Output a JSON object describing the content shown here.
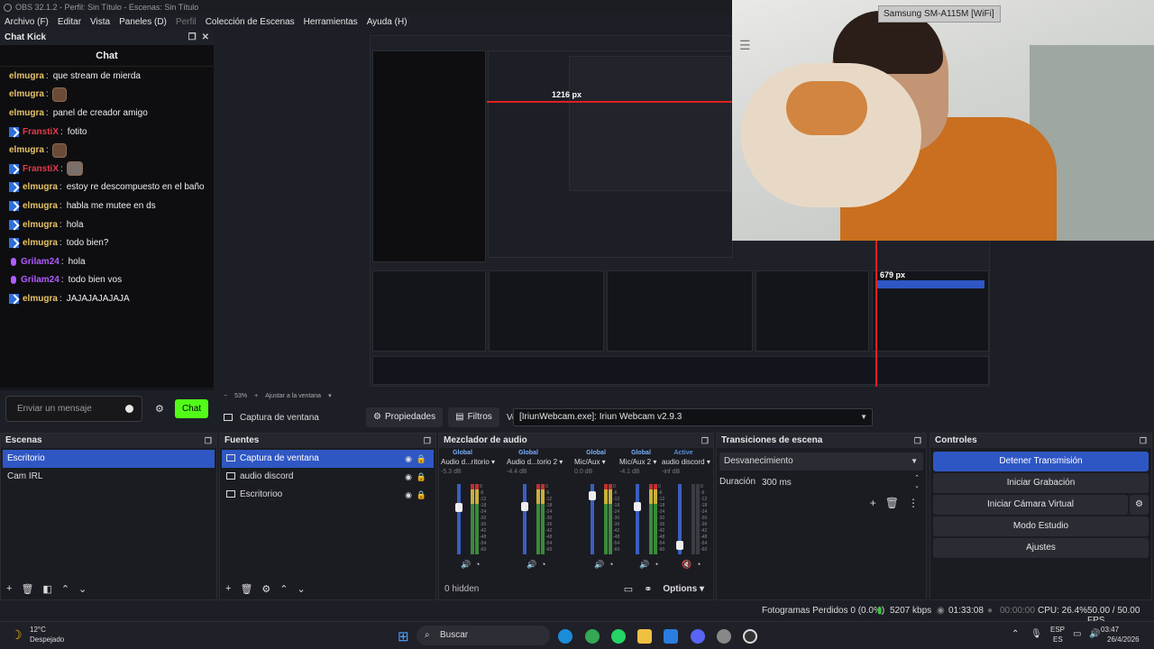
{
  "window": {
    "title": "OBS 32.1.2 - Perfil: Sin Título - Escenas: Sin Título"
  },
  "menu": [
    "Archivo (F)",
    "Editar",
    "Vista",
    "Paneles (D)",
    "Perfil",
    "Colección de Escenas",
    "Herramientas",
    "Ayuda (H)"
  ],
  "chat_dock": {
    "title": "Chat Kick",
    "panel_title": "Chat",
    "messages": [
      {
        "user": "elmugra",
        "text": "que stream de mierda",
        "badge": false,
        "color": "#e8c469",
        "emote": ""
      },
      {
        "user": "elmugra",
        "text": "",
        "badge": false,
        "color": "#e8c469",
        "emote": "face"
      },
      {
        "user": "elmugra",
        "text": "panel de creador amigo",
        "badge": false,
        "color": "#e8c469",
        "emote": ""
      },
      {
        "user": "FranstiX",
        "text": "fotito",
        "badge": true,
        "color": "#e23b4b",
        "emote": ""
      },
      {
        "user": "elmugra",
        "text": "",
        "badge": false,
        "color": "#e8c469",
        "emote": "face"
      },
      {
        "user": "FranstiX",
        "text": "",
        "badge": true,
        "color": "#e23b4b",
        "emote": "cat"
      },
      {
        "user": "elmugra",
        "text": "estoy re descompuesto en el baño",
        "badge": true,
        "color": "#e8c469",
        "emote": ""
      },
      {
        "user": "elmugra",
        "text": "habla me mutee en ds",
        "badge": true,
        "color": "#e8c469",
        "emote": ""
      },
      {
        "user": "elmugra",
        "text": "hola",
        "badge": true,
        "color": "#e8c469",
        "emote": ""
      },
      {
        "user": "elmugra",
        "text": "todo bien?",
        "badge": true,
        "color": "#e8c469",
        "emote": ""
      },
      {
        "user": "Grilam24",
        "text": "hola",
        "badge": "mic",
        "color": "#b05cff",
        "emote": ""
      },
      {
        "user": "Grilam24",
        "text": "todo bien vos",
        "badge": "mic",
        "color": "#b05cff",
        "emote": ""
      },
      {
        "user": "elmugra",
        "text": "JAJAJAJAJAJA",
        "badge": true,
        "color": "#e8c469",
        "emote": ""
      }
    ],
    "input_placeholder": "Enviar un mensaje",
    "send_label": "Chat"
  },
  "preview": {
    "webcam_device": "Samsung SM-A115M [WiFi]",
    "measure_h": "1216 px",
    "measure_v": "679 px",
    "zoom": "53%",
    "zoom_fit": "Ajustar a la ventana"
  },
  "source_toolbar": {
    "source_name": "Captura de ventana",
    "properties": "Propiedades",
    "filters": "Filtros",
    "window_label": "Ventana",
    "window_value": "[IriunWebcam.exe]: Iriun Webcam v2.9.3"
  },
  "scenes": {
    "title": "Escenas",
    "items": [
      "Escritorio",
      "Cam IRL"
    ]
  },
  "sources": {
    "title": "Fuentes",
    "items": [
      "Captura de ventana",
      "audio discord",
      "Escritorioo"
    ]
  },
  "mixer": {
    "title": "Mezclador de audio",
    "channels": [
      {
        "mode": "Global",
        "name": "Audio d...ritorio",
        "db": "-5.3 dB",
        "level": 0.7
      },
      {
        "mode": "Global",
        "name": "Audio d...torio 2",
        "db": "-4.4 dB",
        "level": 0.72
      },
      {
        "mode": "Global",
        "name": "Mic/Aux",
        "db": "0.0 dB",
        "level": 0.88
      },
      {
        "mode": "Global",
        "name": "Mic/Aux 2",
        "db": "-4.1 dB",
        "level": 0.72
      },
      {
        "mode": "Active",
        "name": "audio discord",
        "db": "-inf dB",
        "level": 0.1
      }
    ],
    "ticks": [
      "0",
      "-6",
      "-12",
      "-18",
      "-24",
      "-30",
      "-36",
      "-42",
      "-48",
      "-54",
      "-60"
    ],
    "hidden": "0 hidden",
    "options": "Options"
  },
  "transitions": {
    "title": "Transiciones de escena",
    "selected": "Desvanecimiento",
    "duration_label": "Duración",
    "duration_value": "300 ms"
  },
  "controls": {
    "title": "Controles",
    "stop_stream": "Detener Transmisión",
    "start_rec": "Iniciar Grabación",
    "virtual_cam": "Iniciar Cámara Virtual",
    "studio": "Modo Estudio",
    "settings": "Ajustes"
  },
  "status": {
    "dropped": "Fotogramas Perdidos 0 (0.0%)",
    "bitrate": "5207 kbps",
    "stream_time": "01:33:08",
    "rec_time": "00:00:00",
    "cpu": "CPU: 26.4%",
    "fps": "50.00 / 50.00 FPS"
  },
  "taskbar": {
    "temp": "12°C",
    "weather": "Despejado",
    "search": "Buscar",
    "lang1": "ESP",
    "lang2": "ES",
    "time": "03:47",
    "date": "26/4/2026"
  },
  "colors": {
    "accent": "#2f57c4",
    "kick_green": "#53fc18",
    "record": "#e02020"
  }
}
